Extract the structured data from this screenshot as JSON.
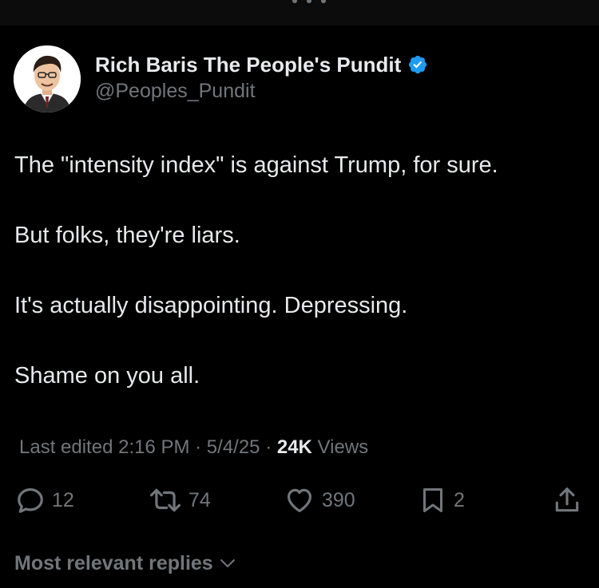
{
  "author": {
    "name": "Rich Baris The People's Pundit",
    "handle": "@Peoples_Pundit",
    "verified": true,
    "verified_color": "#1d9bf0"
  },
  "post": {
    "paragraphs": [
      "The \"intensity index\" is against Trump, for sure.",
      "But folks, they're liars.",
      "It's actually disappointing. Depressing.",
      "Shame on you all."
    ]
  },
  "meta": {
    "edited_label": "Last edited 2:16 PM · 5/4/25",
    "separator": " · ",
    "views_count": "24K",
    "views_label": " Views"
  },
  "actions": {
    "replies": "12",
    "reposts": "74",
    "likes": "390",
    "bookmarks": "2"
  },
  "replies_sort": {
    "label": "Most relevant replies"
  },
  "icons": {
    "reply": "reply-icon",
    "repost": "repost-icon",
    "like": "heart-icon",
    "bookmark": "bookmark-icon",
    "share": "share-icon",
    "verified": "verified-badge-icon",
    "chevron": "chevron-down-icon"
  },
  "colors": {
    "background": "#000000",
    "text": "#e7e9ea",
    "muted": "#71767b"
  }
}
